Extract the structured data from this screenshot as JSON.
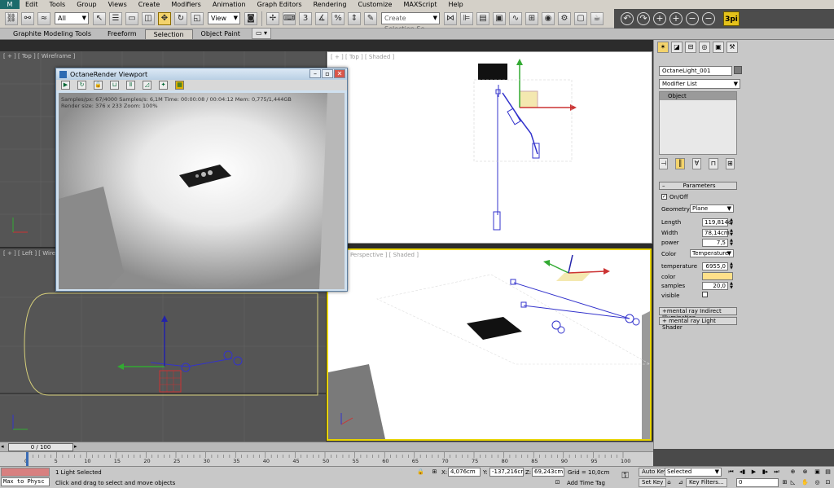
{
  "app": {
    "logo": "M"
  },
  "menus": [
    "Edit",
    "Tools",
    "Group",
    "Views",
    "Create",
    "Modifiers",
    "Animation",
    "Graph Editors",
    "Rendering",
    "Customize",
    "MAXScript",
    "Help"
  ],
  "toolbar": {
    "filter_value": "All",
    "view_value": "View",
    "snap_value": "3",
    "selection_set_placeholder": "Create Selection Se",
    "plugin_label": "3pi"
  },
  "ribbon": {
    "tabs": [
      "Graphite Modeling Tools",
      "Freeform",
      "Selection",
      "Object Paint"
    ],
    "active_tab": "Selection"
  },
  "viewports": {
    "top": "[ + ] [ Top ] [ Shaded ]",
    "perspective": "[ + ] [ Perspective ] [ Shaded ]",
    "top_wire": "[ + ] [ Top ] [ Wireframe ]",
    "left": "[ + ] [ Left ] [ Wireframe ]"
  },
  "octane": {
    "title": "OctaneRender Viewport",
    "stats_line1": "Samples/px: 67/4000    Samples/s: 6,1M    Time: 00:00:08 / 00:04:12    Mem: 0,775/1,444GB",
    "stats_line2": "Render size: 376 x 233    Zoom: 100%"
  },
  "command_panel": {
    "object_name": "OctaneLight_001",
    "modifier_list": "Modifier List",
    "stack_item": "Object",
    "parameters_header": "Parameters",
    "on_off_label": "On/Off",
    "geometry_label": "Geometry",
    "geometry_value": "Plane",
    "length_label": "Length",
    "length_value": "119,814c",
    "width_label": "Width",
    "width_value": "78,14cm",
    "power_label": "power",
    "power_value": "7,5",
    "color_label": "Color",
    "color_value": "Temperature",
    "temperature_label": "temperature",
    "temperature_value": "6955,0",
    "color2_label": "color",
    "swatch_color": "#ffe08a",
    "samples_label": "samples",
    "samples_value": "20,0",
    "visible_label": "visible",
    "rollout_indirect": "mental ray Indirect Illumination",
    "rollout_shader": "mental ray Light Shader"
  },
  "timeline": {
    "slider": "0 / 100",
    "ticks": [
      "0",
      "5",
      "10",
      "15",
      "20",
      "25",
      "30",
      "35",
      "40",
      "45",
      "50",
      "55",
      "60",
      "65",
      "70",
      "75",
      "80",
      "85",
      "90",
      "95",
      "100"
    ]
  },
  "status": {
    "maxscript": "Max to Physc",
    "line1": "1 Light Selected",
    "line2": "Click and drag to select and move objects",
    "x_label": "X:",
    "x_value": "4,076cm",
    "y_label": "Y:",
    "y_value": "-137,216cr",
    "z_label": "Z:",
    "z_value": "69,243cm",
    "grid": "Grid = 10,0cm",
    "add_time_tag": "Add Time Tag",
    "auto_key": "Auto Key",
    "set_key": "Set Key",
    "selected_value": "Selected",
    "key_filters": "Key Filters...",
    "frame_value": "0"
  }
}
